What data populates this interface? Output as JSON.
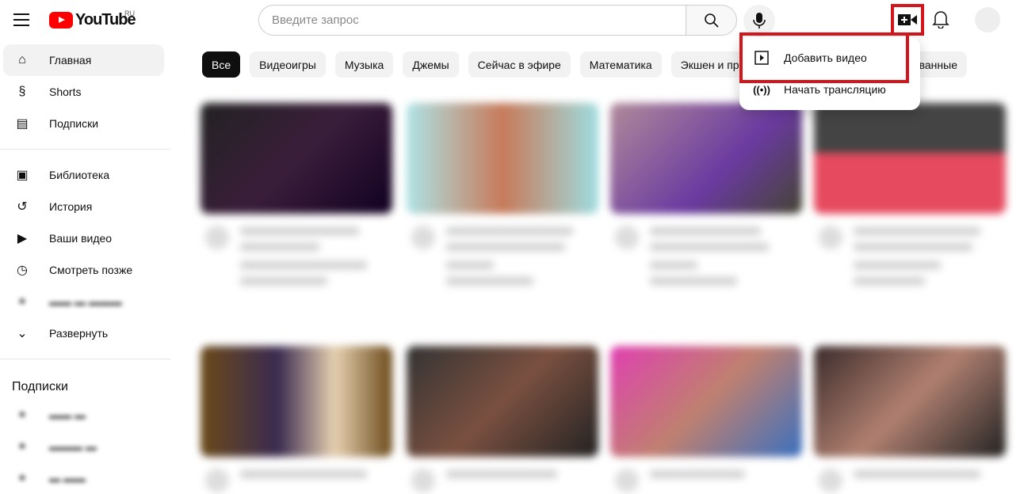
{
  "header": {
    "logo_text": "YouTube",
    "region": "RU",
    "search_placeholder": "Введите запрос"
  },
  "sidebar": {
    "items": [
      {
        "label": "Главная",
        "icon": "home-icon"
      },
      {
        "label": "Shorts",
        "icon": "shorts-icon"
      },
      {
        "label": "Подписки",
        "icon": "subscriptions-icon"
      }
    ],
    "library": [
      {
        "label": "Библиотека",
        "icon": "library-icon"
      },
      {
        "label": "История",
        "icon": "history-icon"
      },
      {
        "label": "Ваши видео",
        "icon": "your-videos-icon"
      },
      {
        "label": "Смотреть позже",
        "icon": "watch-later-icon"
      },
      {
        "label": "Развернуть",
        "icon": "chevron-down-icon"
      }
    ],
    "subscriptions_title": "Подписки"
  },
  "chips": [
    "Все",
    "Видеоигры",
    "Музыка",
    "Джемы",
    "Сейчас в эфире",
    "Математика",
    "Экшен и приключения",
    "Недавно опубликованные"
  ],
  "create_menu": {
    "items": [
      {
        "label": "Добавить видео",
        "icon": "upload-video-icon"
      },
      {
        "label": "Начать трансляцию",
        "icon": "live-broadcast-icon"
      }
    ]
  },
  "colors": {
    "brand": "#ff0000",
    "highlight": "#d3161b"
  }
}
